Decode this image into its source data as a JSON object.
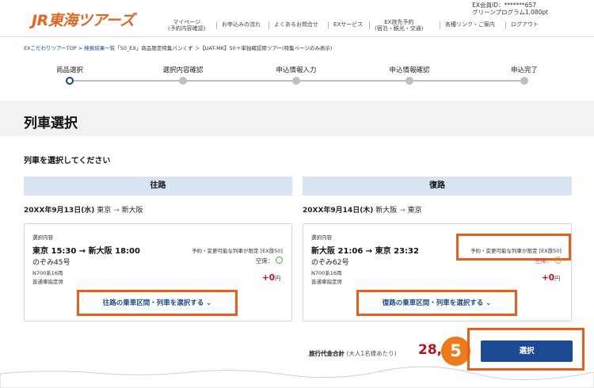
{
  "header": {
    "logo": "JR東海ツアーズ",
    "member_id": "EX会員ID：*******657",
    "member_points": "グリーンプログラム1,080pt",
    "nav": [
      {
        "line1": "マイページ",
        "line2": "(予約内容確認)"
      },
      {
        "line1": "お申込みの流れ",
        "line2": ""
      },
      {
        "line1": "よくあるお問合せ",
        "line2": ""
      },
      {
        "line1": "EXサービス",
        "line2": ""
      },
      {
        "line1": "EX旅先予約",
        "line2": "(宿泊・観光・交通)"
      },
      {
        "line1": "各種リンク・ご案内",
        "line2": ""
      },
      {
        "line1": "ログアウト",
        "line2": ""
      }
    ]
  },
  "breadcrumb": {
    "link1": "EXこだわりツアーTOP",
    "sep": " > ",
    "link2": "検索結果一覧",
    "rest": "「50_EX」商品限定特集パンくず ＞【UAT-MK】50＋単独確認用ツアー(特集ページのみ表示)"
  },
  "steps": [
    "商品選択",
    "選択内容確認",
    "申込情報入力",
    "申込情報確認",
    "申込完了"
  ],
  "page_title": "列車選択",
  "subtitle": "列車を選択してください",
  "outbound": {
    "header": "往路",
    "date": "20XX年9月13日(水)",
    "from": "東京",
    "arrow": "→",
    "to": "新大阪",
    "label": "選択内容",
    "times": "東京 15:30 → 新大阪 18:00",
    "note": "予約・変更可能な列車が限定 [EX旅50]",
    "train": "のぞみ45号",
    "car": "N700系16両",
    "seat": "普通車指定席",
    "avail": "空席：",
    "price": "+0",
    "yen": "円",
    "select_btn": "往路の乗車区間・列車を選択する ⌄"
  },
  "return": {
    "header": "復路",
    "date": "20XX年9月14日(木)",
    "from": "新大阪",
    "arrow": "→",
    "to": "東京",
    "label": "選択内容",
    "times": "新大阪 21:06 → 東京 23:32",
    "note": "予約・変更可能な列車が限定 [EX旅50]",
    "train": "のぞみ62号",
    "car": "N700系16両",
    "seat": "普通車指定席",
    "avail": "空席：",
    "price": "+0",
    "yen": "円",
    "select_btn": "復路の乗車区間・列車を選択する ⌄"
  },
  "footer": {
    "total_label": "旅行代金合計",
    "total_note": "(大人1名様あたり)",
    "amount": "28,",
    "badge": "5",
    "select": "選択"
  },
  "colors": {
    "accent": "#e85e1a",
    "primary": "#1c4a95",
    "price": "#c0111a",
    "header_bg": "#d8e4f3"
  }
}
